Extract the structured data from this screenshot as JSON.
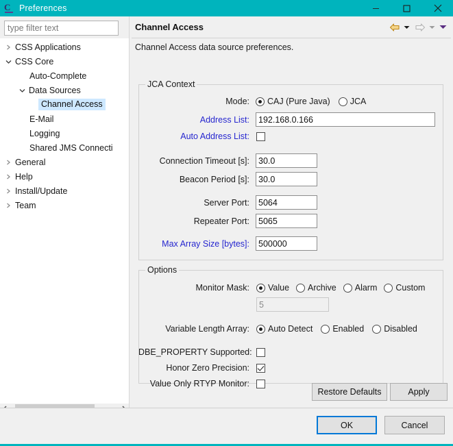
{
  "window": {
    "title": "Preferences",
    "icon": "css-logo-icon",
    "accent_color": "#00b4bd",
    "controls": {
      "minimize": "minimize-icon",
      "maximize": "maximize-icon",
      "close": "close-icon"
    }
  },
  "sidebar": {
    "filter": {
      "value": "",
      "placeholder": "type filter text"
    },
    "items": [
      {
        "label": "CSS Applications",
        "indent": 0,
        "twisty": "collapsed",
        "selected": false
      },
      {
        "label": "CSS Core",
        "indent": 0,
        "twisty": "expanded",
        "selected": false
      },
      {
        "label": "Auto-Complete",
        "indent": 1,
        "twisty": "none",
        "selected": false
      },
      {
        "label": "Data Sources",
        "indent": 1,
        "twisty": "expanded",
        "selected": false
      },
      {
        "label": "Channel Access",
        "indent": 2,
        "twisty": "none",
        "selected": true
      },
      {
        "label": "E-Mail",
        "indent": 1,
        "twisty": "none",
        "selected": false
      },
      {
        "label": "Logging",
        "indent": 1,
        "twisty": "none",
        "selected": false
      },
      {
        "label": "Shared JMS Connecti",
        "indent": 1,
        "twisty": "none",
        "selected": false
      },
      {
        "label": "General",
        "indent": 0,
        "twisty": "collapsed",
        "selected": false
      },
      {
        "label": "Help",
        "indent": 0,
        "twisty": "collapsed",
        "selected": false
      },
      {
        "label": "Install/Update",
        "indent": 0,
        "twisty": "collapsed",
        "selected": false
      },
      {
        "label": "Team",
        "indent": 0,
        "twisty": "collapsed",
        "selected": false
      }
    ],
    "scrollbar": {
      "left_arrow": "chevron-left-icon",
      "right_arrow": "chevron-right-icon"
    }
  },
  "page": {
    "title": "Channel Access",
    "description": "Channel Access data source preferences.",
    "nav": {
      "back": "back-arrow-icon",
      "back_color": "#d9a029",
      "back_menu": "chevron-down-icon",
      "forward": "forward-arrow-icon",
      "forward_color": "#b9b9b9",
      "forward_menu": "chevron-down-icon",
      "view_menu": "chevron-down-icon",
      "view_menu_color": "#5a2d82"
    }
  },
  "jca_context": {
    "legend": "JCA Context",
    "mode": {
      "label": "Mode:",
      "options": [
        {
          "label": "CAJ (Pure Java)",
          "selected": true
        },
        {
          "label": "JCA",
          "selected": false
        }
      ]
    },
    "address_list": {
      "label": "Address List:",
      "value": "192.168.0.166",
      "link": true
    },
    "auto_address_list": {
      "label": "Auto Address List:",
      "checked": false,
      "link": true
    },
    "connection_timeout": {
      "label": "Connection Timeout [s]:",
      "value": "30.0",
      "link": false
    },
    "beacon_period": {
      "label": "Beacon Period [s]:",
      "value": "30.0",
      "link": false
    },
    "server_port": {
      "label": "Server Port:",
      "value": "5064",
      "link": false
    },
    "repeater_port": {
      "label": "Repeater Port:",
      "value": "5065",
      "link": false
    },
    "max_array_size": {
      "label": "Max Array Size [bytes]:",
      "value": "500000",
      "link": true
    }
  },
  "options": {
    "legend": "Options",
    "monitor_mask": {
      "label": "Monitor Mask:",
      "options": [
        {
          "label": "Value",
          "selected": true
        },
        {
          "label": "Archive",
          "selected": false
        },
        {
          "label": "Alarm",
          "selected": false
        },
        {
          "label": "Custom",
          "selected": false
        }
      ],
      "custom_value": "5",
      "custom_enabled": false
    },
    "variable_length_array": {
      "label": "Variable Length Array:",
      "options": [
        {
          "label": "Auto Detect",
          "selected": true
        },
        {
          "label": "Enabled",
          "selected": false
        },
        {
          "label": "Disabled",
          "selected": false
        }
      ]
    },
    "checkboxes": [
      {
        "label": "DBE_PROPERTY Supported:",
        "checked": false
      },
      {
        "label": "Honor Zero Precision:",
        "checked": true
      },
      {
        "label": "Value Only RTYP Monitor:",
        "checked": false
      }
    ]
  },
  "buttons": {
    "restore_defaults": "Restore Defaults",
    "apply": "Apply",
    "ok": "OK",
    "cancel": "Cancel"
  }
}
